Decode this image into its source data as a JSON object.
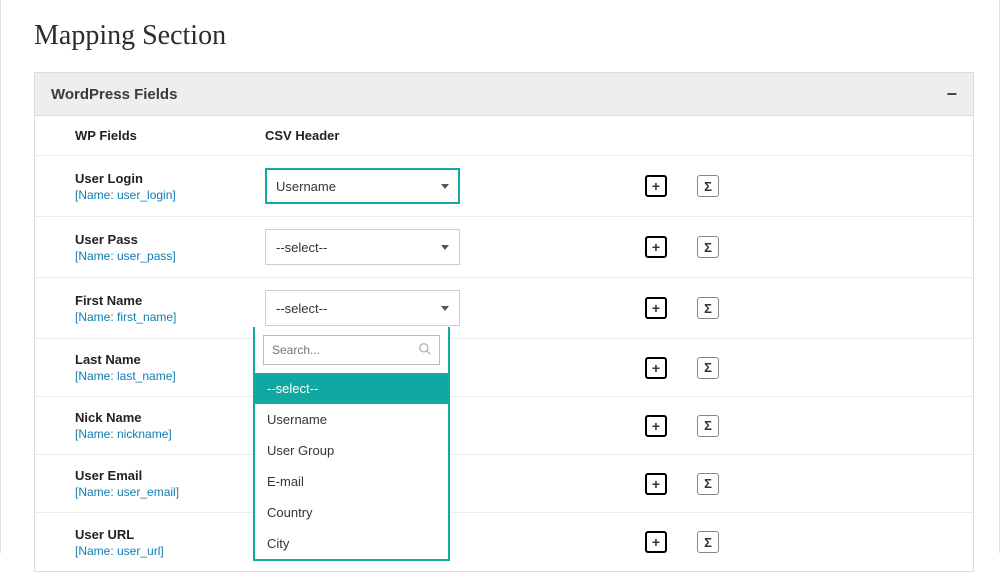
{
  "page": {
    "title": "Mapping Section"
  },
  "panel": {
    "title": "WordPress Fields",
    "collapse_symbol": "−"
  },
  "column_headers": {
    "wp": "WP Fields",
    "csv": "CSV Header"
  },
  "actions": {
    "plus": "+",
    "sigma": "Σ"
  },
  "select_placeholder": "--select--",
  "row_user_login": {
    "label": "User Login",
    "slug": "[Name: user_login]",
    "selected": "Username",
    "active": true
  },
  "row_user_pass": {
    "label": "User Pass",
    "slug": "[Name: user_pass]",
    "selected": "--select--",
    "active": false
  },
  "row_first_name": {
    "label": "First Name",
    "slug": "[Name: first_name]",
    "selected": "--select--",
    "active": false,
    "dropdown_open": true
  },
  "row_last_name": {
    "label": "Last Name",
    "slug": "[Name: last_name]",
    "selected": null
  },
  "row_nick_name": {
    "label": "Nick Name",
    "slug": "[Name: nickname]",
    "selected": null
  },
  "row_user_email": {
    "label": "User Email",
    "slug": "[Name: user_email]",
    "selected": null
  },
  "row_user_url": {
    "label": "User URL",
    "slug": "[Name: user_url]",
    "selected": null
  },
  "dropdown": {
    "search_placeholder": "Search...",
    "opt0": "--select--",
    "opt1": "Username",
    "opt2": "User Group",
    "opt3": "E-mail",
    "opt4": "Country",
    "opt5": "City"
  }
}
